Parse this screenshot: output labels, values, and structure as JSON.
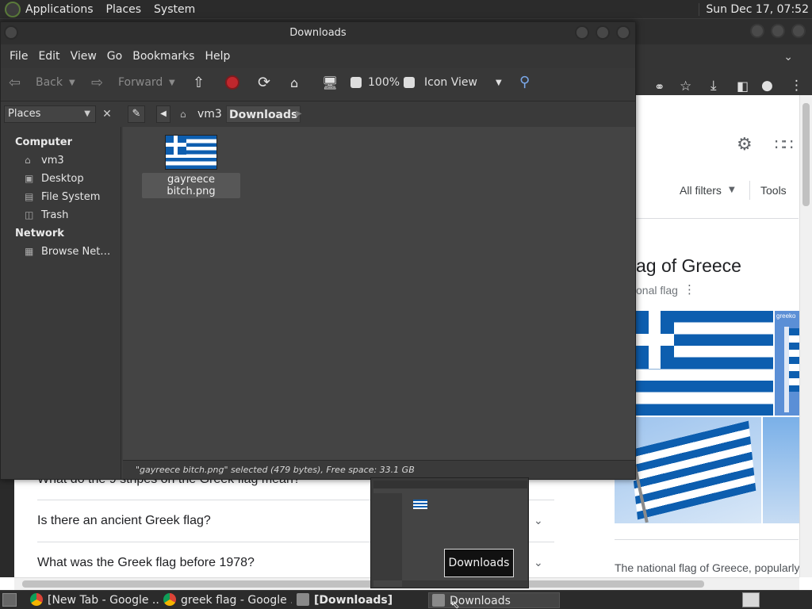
{
  "top_panel": {
    "menus": [
      "Applications",
      "Places",
      "System"
    ],
    "clock": "Sun Dec 17, 07:52"
  },
  "browser": {
    "page": {
      "filters": "All filters",
      "tools": "Tools",
      "knowledge_title": "ag of Greece",
      "knowledge_subtitle": "onal flag",
      "image_badge": "greeko",
      "description": "The national flag of Greece, popularly",
      "faq": [
        "What do the 9 stripes on the Greek flag mean?",
        "Is there an ancient Greek flag?",
        "What was the Greek flag before 1978?"
      ]
    }
  },
  "file_manager": {
    "title": "Downloads",
    "menus": [
      "File",
      "Edit",
      "View",
      "Go",
      "Bookmarks",
      "Help"
    ],
    "toolbar": {
      "back": "Back",
      "forward": "Forward",
      "zoom": "100%",
      "view_mode": "Icon View"
    },
    "sidebar": {
      "selector": "Places",
      "sections": [
        {
          "heading": "Computer",
          "items": [
            "vm3",
            "Desktop",
            "File System",
            "Trash"
          ]
        },
        {
          "heading": "Network",
          "items": [
            "Browse Net…"
          ]
        }
      ]
    },
    "breadcrumbs": [
      "vm3",
      "Downloads"
    ],
    "files": [
      {
        "name": "gayreece bitch.png"
      }
    ],
    "status": "\"gayreece bitch.png\" selected (479 bytes), Free space: 33.1 GB"
  },
  "preview_tooltip": "Downloads",
  "taskbar": {
    "tasks": [
      "[New Tab - Google ...",
      "greek flag - Google ...",
      "[Downloads]",
      "Downloads"
    ]
  },
  "colors": {
    "greek_blue": "#0d5eaf",
    "panel_bg": "#2b2b2b",
    "window_bg": "#3d3d3d"
  }
}
